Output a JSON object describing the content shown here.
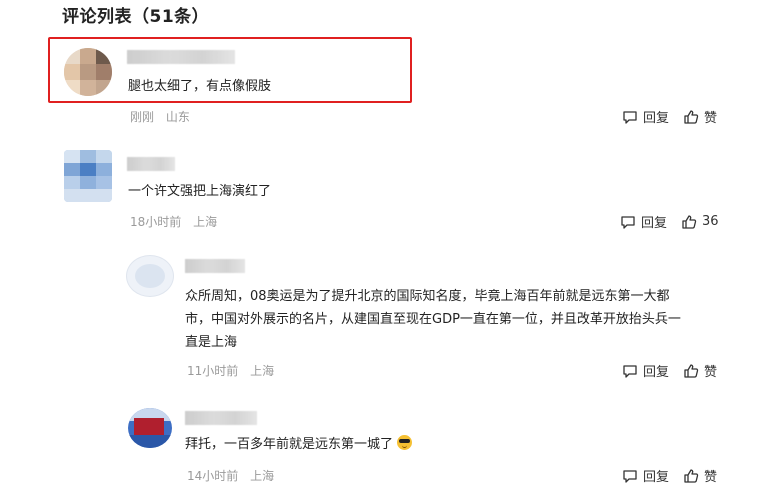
{
  "header": {
    "title": "评论列表（51条）"
  },
  "actions": {
    "reply_label": "回复",
    "like_label": "赞"
  },
  "comments": [
    {
      "text": "腿也太细了，有点像假肢",
      "time": "刚刚",
      "location": "山东",
      "like_display": "赞",
      "highlighted": true
    },
    {
      "text": "一个许文强把上海演红了",
      "time": "18小时前",
      "location": "上海",
      "like_display": "36"
    },
    {
      "text_line1": "众所周知，08奥运是为了提升北京的国际知名度，毕竟上海百年前就是远东第一大都",
      "text_line2": "市，中国对外展示的名片，从建国直至现在GDP一直在第一位，并且改革开放抬头兵一",
      "text_line3": "直是上海",
      "time": "11小时前",
      "location": "上海",
      "like_display": "赞"
    },
    {
      "text": "拜托，一百多年前就是远东第一城了",
      "emoji": "sunglasses-emoji",
      "time": "14小时前",
      "location": "上海",
      "like_display": "赞"
    }
  ],
  "colors": {
    "highlight_border": "#e02020",
    "meta_text": "#9a9a9a"
  }
}
